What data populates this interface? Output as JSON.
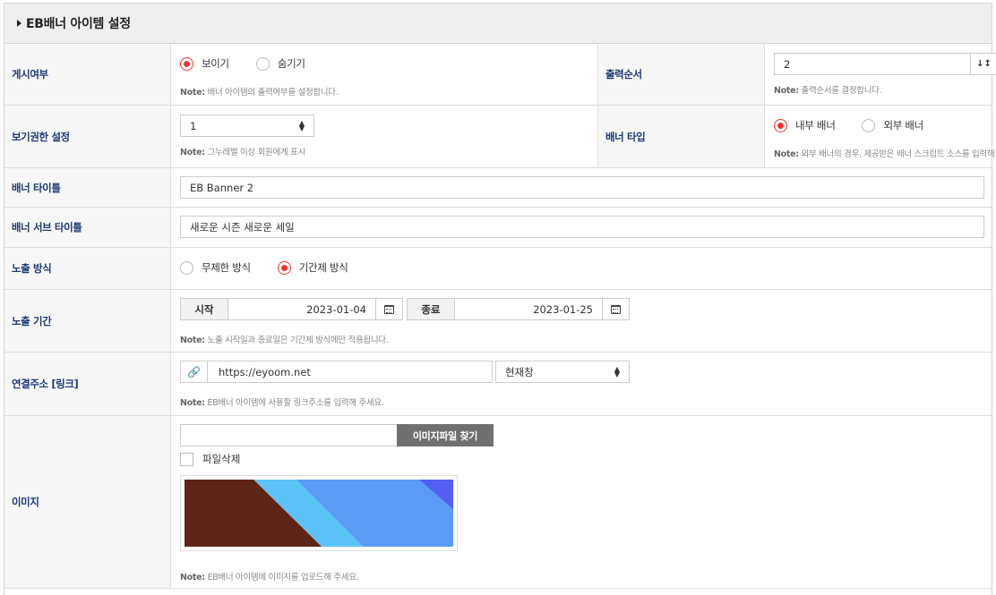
{
  "section": {
    "title": "EB배너 아이템 설정"
  },
  "display": {
    "label": "게시여부",
    "options": [
      "보이기",
      "숨기기"
    ],
    "selected": 0,
    "note_prefix": "Note:",
    "note": "배너 아이템의 출력여부를 설정합니다."
  },
  "order": {
    "label": "출력순서",
    "value": "2",
    "note_prefix": "Note:",
    "note": "출력순서를 결정합니다."
  },
  "permission": {
    "label": "보기권한 설정",
    "value": "1",
    "note_prefix": "Note:",
    "note": "그누레벨 이상 회원에게 표시"
  },
  "banner_type": {
    "label": "배너 타입",
    "options": [
      "내부 배너",
      "외부 배너"
    ],
    "selected": 0,
    "note_prefix": "Note:",
    "note": "외부 배너의 경우, 제공받은 배너 스크립트 소스를 입력해 주세요."
  },
  "banner_title": {
    "label": "배너 타이틀",
    "value": "EB Banner 2"
  },
  "banner_subtitle": {
    "label": "배너 서브 타이틀",
    "value": "새로운 시즌 새로운 세일"
  },
  "exposure_method": {
    "label": "노출 방식",
    "options": [
      "무제한 방식",
      "기간제 방식"
    ],
    "selected": 1
  },
  "exposure_period": {
    "label": "노출 기간",
    "start_label": "시작",
    "start_value": "2023-01-04",
    "end_label": "종료",
    "end_value": "2023-01-25",
    "note_prefix": "Note:",
    "note": "노출 시작일과 종료일은 기간제 방식에만 적용됩니다."
  },
  "link": {
    "label": "연결주소 [링크]",
    "url": "https://eyoom.net",
    "target": "현재창",
    "note_prefix": "Note:",
    "note": "EB배너 아이템에 사용할 링크주소를 입력해 주세요."
  },
  "image": {
    "label": "이미지",
    "find_button": "이미지파일 찾기",
    "delete_label": "파일삭제",
    "note_prefix": "Note:",
    "note": "EB배너 아이템에 이미지를 업로드해 주세요.",
    "colors": [
      "#5e2518",
      "#5bc3f7",
      "#5b9bf7",
      "#5560f2"
    ]
  }
}
